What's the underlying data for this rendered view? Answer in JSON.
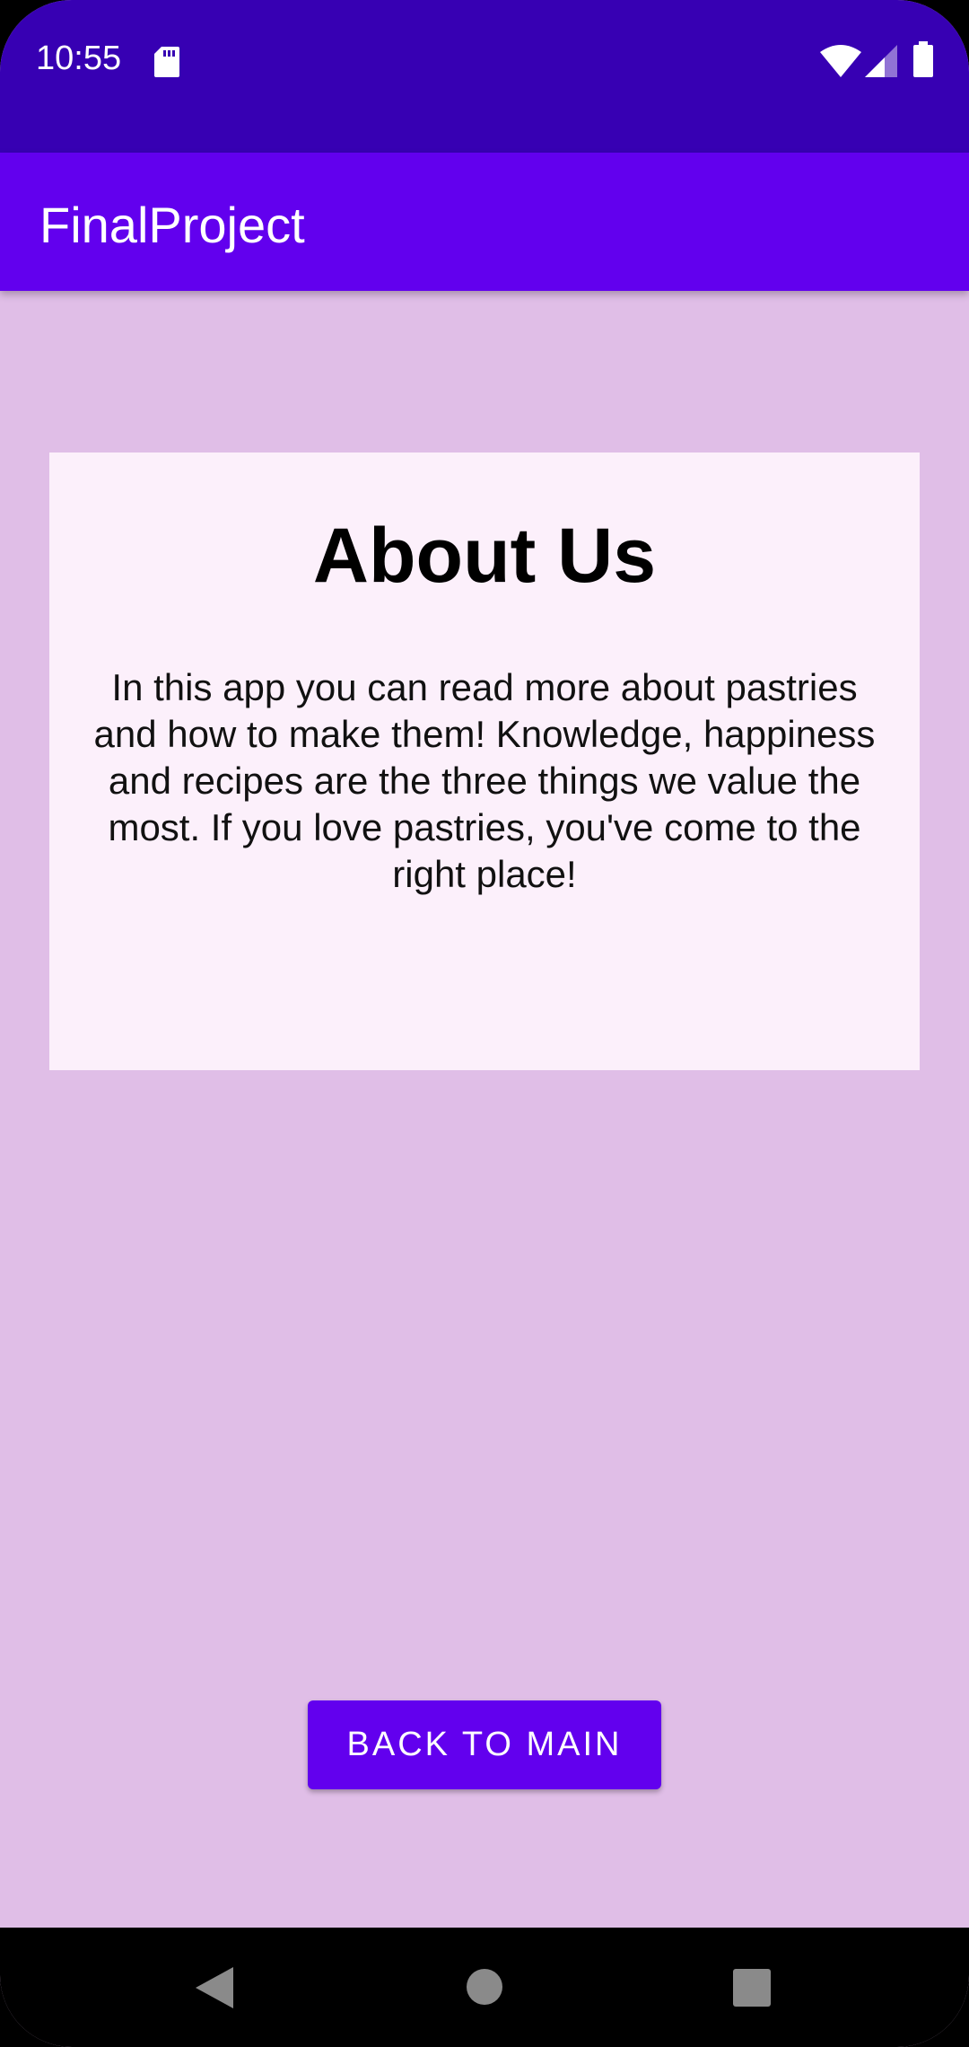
{
  "status_bar": {
    "time": "10:55",
    "icons": [
      "sd-card-icon",
      "wifi-icon",
      "signal-icon",
      "battery-icon"
    ],
    "color": "#3700B3"
  },
  "app_bar": {
    "title": "FinalProject",
    "color": "#6200EE"
  },
  "card": {
    "title": "About Us",
    "body": "In this app you can read more about pastries and how to make them! Knowledge, happiness and recipes are the three things we value the most. If you love pastries, you've come to the right place!",
    "background": "#FCF0FB"
  },
  "actions": {
    "back_label": "BACK TO MAIN"
  },
  "nav_bar": {
    "icons": [
      "back-icon",
      "home-icon",
      "recents-icon"
    ]
  },
  "colors": {
    "page_background": "#E0BEE7",
    "accent": "#6200EE",
    "status_bar": "#3700B3"
  }
}
